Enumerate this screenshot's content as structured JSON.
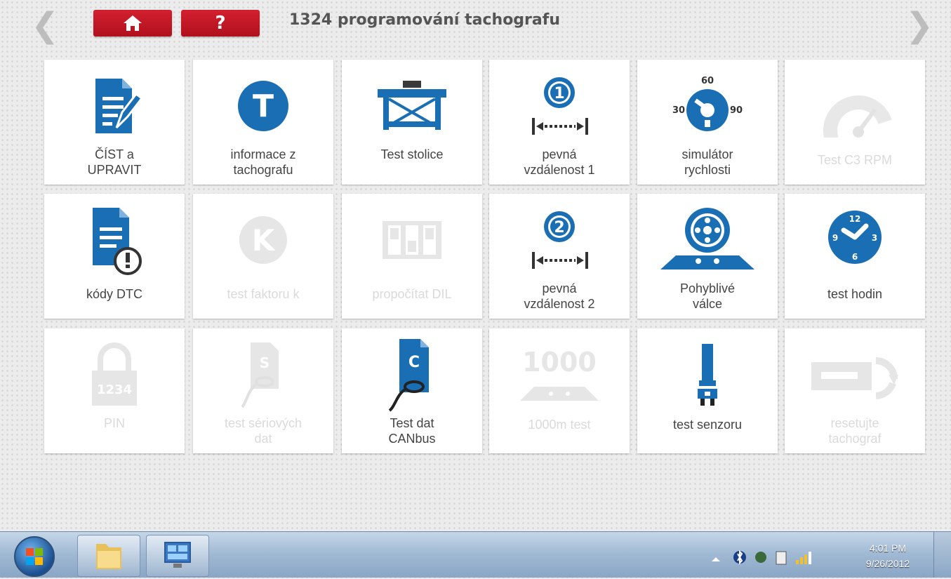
{
  "header": {
    "prev_arrow": "❮",
    "next_arrow": "❯",
    "help_label": "?",
    "title": "1324 programování tachografu"
  },
  "tiles": [
    {
      "label_1": "ČÍST a",
      "label_2": "UPRAVIT",
      "icon": "edit-document-icon",
      "enabled": true
    },
    {
      "label_1": "informace z",
      "label_2": "tachografu",
      "icon": "letter-t-circle-icon",
      "enabled": true
    },
    {
      "label_1": "Test stolice",
      "label_2": "",
      "icon": "test-bench-icon",
      "enabled": true
    },
    {
      "label_1": "pevná",
      "label_2": "vzdálenost 1",
      "icon": "fixed-distance-1-icon",
      "enabled": true
    },
    {
      "label_1": "simulátor",
      "label_2": "rychlosti",
      "icon": "speed-dial-icon",
      "enabled": true
    },
    {
      "label_1": "Test C3 RPM",
      "label_2": "",
      "icon": "rpm-gauge-icon",
      "enabled": false
    },
    {
      "label_1": "kódy DTC",
      "label_2": "",
      "icon": "document-warning-icon",
      "enabled": true
    },
    {
      "label_1": "test faktoru k",
      "label_2": "",
      "icon": "letter-k-circle-icon",
      "enabled": false
    },
    {
      "label_1": "propočítat DIL",
      "label_2": "",
      "icon": "dil-switch-icon",
      "enabled": false
    },
    {
      "label_1": "pevná",
      "label_2": "vzdálenost 2",
      "icon": "fixed-distance-2-icon",
      "enabled": true
    },
    {
      "label_1": "Pohyblivé",
      "label_2": "válce",
      "icon": "rolling-road-icon",
      "enabled": true
    },
    {
      "label_1": "test hodin",
      "label_2": "",
      "icon": "clock-icon",
      "enabled": true
    },
    {
      "label_1": "PIN",
      "label_2": "",
      "icon": "padlock-icon",
      "enabled": false
    },
    {
      "label_1": "test sériových",
      "label_2": "dat",
      "icon": "serial-document-icon",
      "enabled": false
    },
    {
      "label_1": "Test dat",
      "label_2": "CANbus",
      "icon": "canbus-document-icon",
      "enabled": true
    },
    {
      "label_1": "1000m test",
      "label_2": "",
      "icon": "1000m-icon",
      "enabled": false
    },
    {
      "label_1": "test senzoru",
      "label_2": "",
      "icon": "sensor-icon",
      "enabled": true
    },
    {
      "label_1": "resetujte",
      "label_2": "tachograf",
      "icon": "reset-tachograph-icon",
      "enabled": false
    }
  ],
  "icon_text": {
    "dist1_num": "1",
    "dist2_num": "2",
    "t_letter": "T",
    "k_letter": "K",
    "speed_30": "30",
    "speed_60": "60",
    "speed_90": "90",
    "clock_12": "12",
    "clock_3": "3",
    "clock_6": "6",
    "clock_9": "9",
    "pin_num": "1234",
    "serial_letter": "S",
    "can_letter": "C",
    "km_1000": "1000"
  },
  "taskbar": {
    "clock_time": "4:01 PM",
    "clock_date": "9/26/2012"
  },
  "colors": {
    "accent_blue": "#1a6fb4",
    "header_red": "#c8182a",
    "disabled_gray": "#e2e2e2"
  }
}
